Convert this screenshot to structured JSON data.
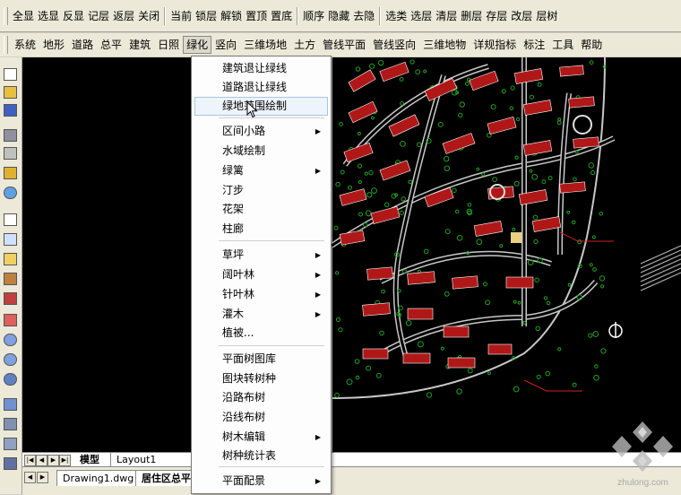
{
  "toolbar_top": [
    "全显",
    "选显",
    "反显",
    "记层",
    "返层",
    "关闭",
    "当前",
    "锁层",
    "解锁",
    "置顶",
    "置底",
    "顺序",
    "隐藏",
    "去隐",
    "选类",
    "选层",
    "清层",
    "删层",
    "存层",
    "改层",
    "层树"
  ],
  "menubar": [
    "系统",
    "地形",
    "道路",
    "总平",
    "建筑",
    "日照",
    "绿化",
    "竖向",
    "三维场地",
    "土方",
    "管线平面",
    "管线竖向",
    "三维地物",
    "详规指标",
    "标注",
    "工具",
    "帮助"
  ],
  "active_menu": "绿化",
  "dropdown": [
    {
      "label": "建筑退让绿线",
      "submenu": false
    },
    {
      "label": "道路退让绿线",
      "submenu": false
    },
    {
      "label": "绿地范围绘制",
      "submenu": false,
      "highlighted": true
    },
    {
      "label": "区间小路",
      "submenu": true
    },
    {
      "label": "水域绘制",
      "submenu": false
    },
    {
      "label": "绿篱",
      "submenu": true
    },
    {
      "label": "汀步",
      "submenu": false
    },
    {
      "label": "花架",
      "submenu": false
    },
    {
      "label": "柱廊",
      "submenu": false
    },
    {
      "label": "草坪",
      "submenu": true
    },
    {
      "label": "阔叶林",
      "submenu": true
    },
    {
      "label": "针叶林",
      "submenu": true
    },
    {
      "label": "灌木",
      "submenu": true
    },
    {
      "label": "植被...",
      "submenu": false
    },
    {
      "label": "平面树图库",
      "submenu": false
    },
    {
      "label": "图块转树种",
      "submenu": false
    },
    {
      "label": "沿路布树",
      "submenu": false
    },
    {
      "label": "沿线布树",
      "submenu": false
    },
    {
      "label": "树木编辑",
      "submenu": true
    },
    {
      "label": "树种统计表",
      "submenu": false
    },
    {
      "label": "平面配景",
      "submenu": true
    }
  ],
  "layout_tabs": [
    "模型",
    "Layout1"
  ],
  "file_tabs": [
    "Drawing1.dwg",
    "居住区总平面"
  ],
  "watermark": "zhulong.com",
  "arrow_glyph": "▶",
  "colors": {
    "canvas": "#000000",
    "road": "#c8c8c8",
    "building": "#b01818",
    "green": "#1fa01f",
    "highlight_border": "#a9c4e4"
  }
}
